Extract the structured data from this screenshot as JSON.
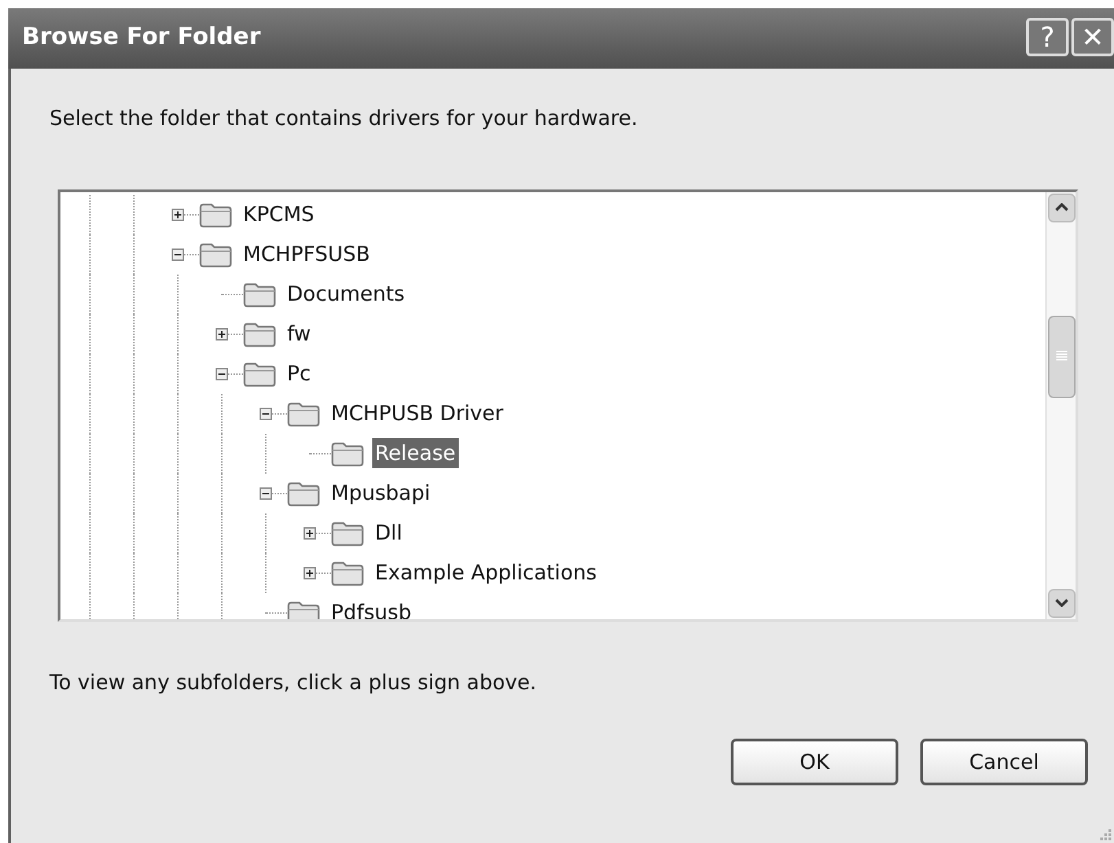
{
  "window": {
    "title": "Browse For Folder",
    "title_buttons": [
      "?",
      "✕"
    ]
  },
  "instruction": "Select the folder that contains drivers for your hardware.",
  "tree": [
    {
      "label": "KPCMS",
      "kind": "branch",
      "expanded": false,
      "selected": false
    },
    {
      "label": "MCHPFSUSB",
      "kind": "branch",
      "expanded": true,
      "selected": false,
      "children": [
        {
          "label": "Documents",
          "kind": "leaf",
          "selected": false
        },
        {
          "label": "fw",
          "kind": "branch",
          "expanded": false,
          "selected": false
        },
        {
          "label": "Pc",
          "kind": "branch",
          "expanded": true,
          "selected": false,
          "children": [
            {
              "label": "MCHPUSB Driver",
              "kind": "branch",
              "expanded": true,
              "selected": false,
              "children": [
                {
                  "label": "Release",
                  "kind": "leaf",
                  "selected": true
                }
              ]
            },
            {
              "label": "Mpusbapi",
              "kind": "branch",
              "expanded": true,
              "selected": false,
              "children": [
                {
                  "label": "Dll",
                  "kind": "branch",
                  "expanded": false,
                  "selected": false
                },
                {
                  "label": "Example Applications",
                  "kind": "branch",
                  "expanded": false,
                  "selected": false
                }
              ]
            },
            {
              "label": "Pdfsusb",
              "kind": "leaf",
              "selected": false
            }
          ]
        }
      ]
    }
  ],
  "hint": "To view any subfolders, click a plus sign above.",
  "buttons": [
    "OK",
    "Cancel"
  ]
}
